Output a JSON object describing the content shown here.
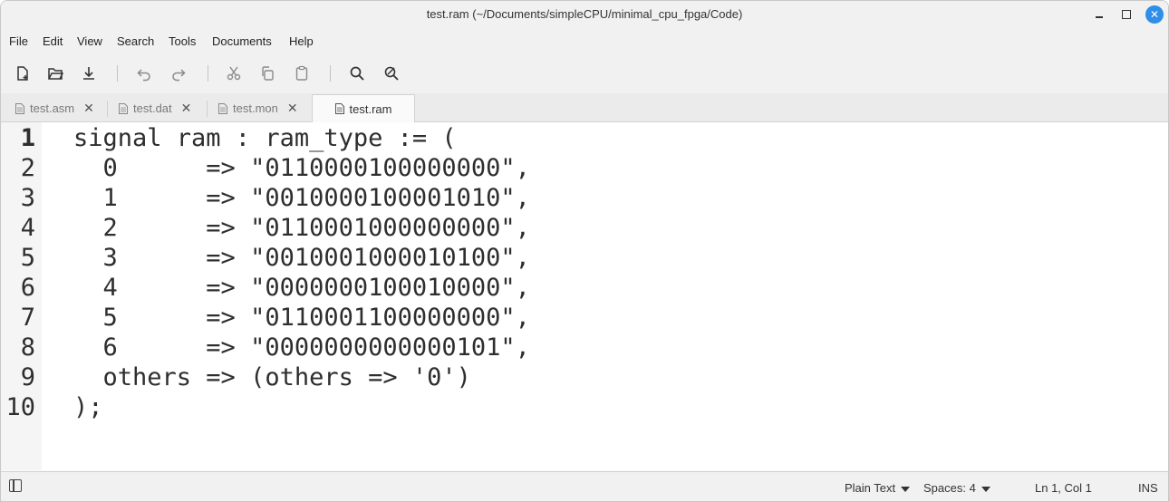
{
  "window": {
    "title": "test.ram (~/Documents/simpleCPU/minimal_cpu_fpga/Code)"
  },
  "menu": [
    "File",
    "Edit",
    "View",
    "Search",
    "Tools",
    "Documents",
    "Help"
  ],
  "tabs": [
    {
      "label": "test.asm",
      "active": false
    },
    {
      "label": "test.dat",
      "active": false
    },
    {
      "label": "test.mon",
      "active": false
    },
    {
      "label": "test.ram",
      "active": true
    }
  ],
  "editor": {
    "current_line": 1,
    "line_numbers": [
      "1",
      "2",
      "3",
      "4",
      "5",
      "6",
      "7",
      "8",
      "9",
      "10"
    ],
    "lines": [
      "signal ram : ram_type := (",
      "  0      => \"0110000100000000\",",
      "  1      => \"0010000100001010\",",
      "  2      => \"0110001000000000\",",
      "  3      => \"0010001000010100\",",
      "  4      => \"0000000100010000\",",
      "  5      => \"0110001100000000\",",
      "  6      => \"0000000000000101\",",
      "  others => (others => '0')",
      ");"
    ]
  },
  "status": {
    "language": "Plain Text",
    "spaces": "Spaces: 4",
    "position": "Ln 1, Col 1",
    "mode": "INS"
  },
  "colors": {
    "accent": "#2f8ee8",
    "chrome": "#f1f1f1"
  }
}
